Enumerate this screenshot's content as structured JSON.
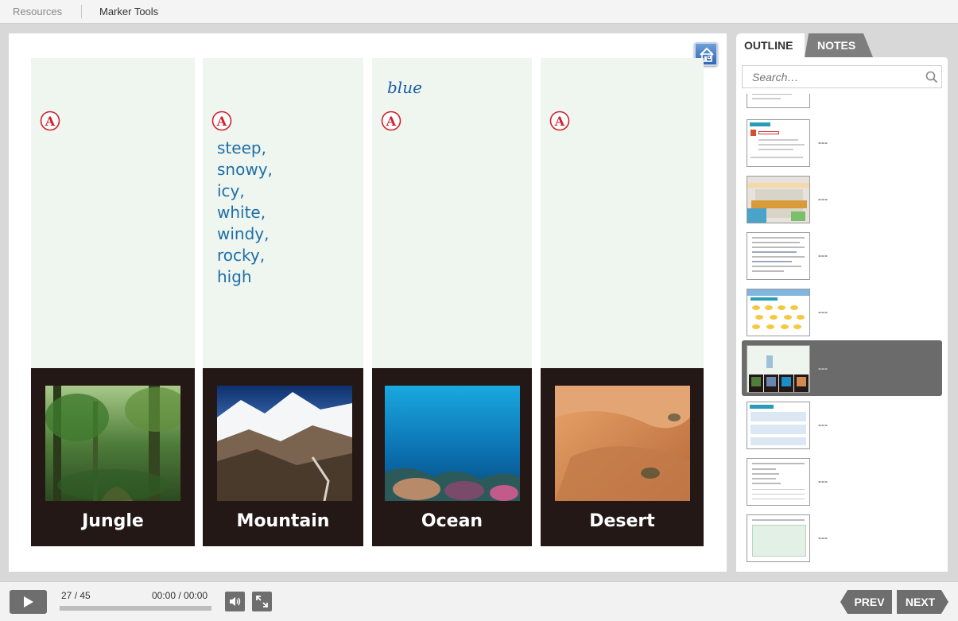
{
  "topbar": {
    "resources_label": "Resources",
    "marker_tools_label": "Marker Tools"
  },
  "slide": {
    "columns": [
      {
        "label": "Jungle",
        "answer": "",
        "handwritten": ""
      },
      {
        "label": "Mountain",
        "answer": "steep,\nsnowy,\nicy,\nwhite,\nwindy,\nrocky,\nhigh",
        "handwritten": ""
      },
      {
        "label": "Ocean",
        "answer": "",
        "handwritten": "blue"
      },
      {
        "label": "Desert",
        "answer": "",
        "handwritten": ""
      }
    ],
    "answer_icon_letter": "A",
    "home_icon": "home-icon",
    "colors": {
      "column_bg": "#eff5ef",
      "label_bg": "#231815",
      "answer_text": "#1d6fa8",
      "answer_icon": "#d0202a"
    }
  },
  "sidebar": {
    "tabs": [
      {
        "label": "OUTLINE",
        "active": true
      },
      {
        "label": "NOTES",
        "active": false
      }
    ],
    "search": {
      "placeholder": "Search…",
      "value": ""
    },
    "thumbnails": [
      {
        "title": "",
        "kind": "partial"
      },
      {
        "title": "---",
        "kind": "text-red"
      },
      {
        "title": "---",
        "kind": "map"
      },
      {
        "title": "---",
        "kind": "text"
      },
      {
        "title": "---",
        "kind": "dots"
      },
      {
        "title": "---",
        "kind": "columns",
        "active": true
      },
      {
        "title": "---",
        "kind": "text-blue"
      },
      {
        "title": "---",
        "kind": "list"
      },
      {
        "title": "---",
        "kind": "green-box"
      }
    ]
  },
  "controls": {
    "page_current": "27",
    "page_total": "/ 45",
    "time_current": "00:00",
    "time_total": "/ 00:00",
    "prev_label": "PREV",
    "next_label": "NEXT"
  }
}
